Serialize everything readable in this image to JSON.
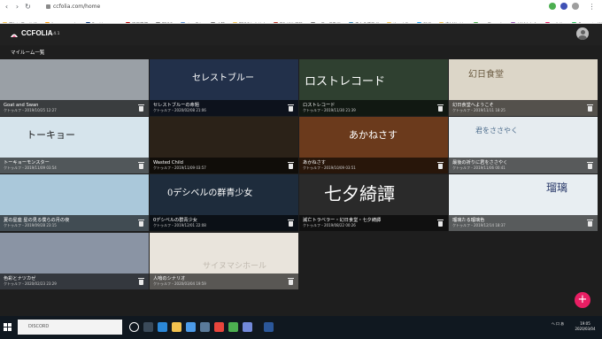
{
  "browser": {
    "url": "ccfolia.com/home",
    "bookmarks": [
      "新しいフォルダ",
      "Amazon.co.jp",
      "Booking.com",
      "楽天市場",
      "TRPG",
      "キャラシ",
      "人狼",
      "TRPGシナリオ",
      "TO-KIX 忍殺",
      "ニコニコ動画",
      "赤小のブログ",
      "ゆっくり",
      "SNS",
      "素材サイト",
      "ユニフォーム",
      "どどんとふ",
      "ccfolia",
      "Evernote Web"
    ],
    "icons": [
      "back-icon",
      "forward-icon",
      "reload-icon",
      "lock-icon",
      "extension-icon",
      "profile-icon",
      "menu-icon"
    ]
  },
  "app": {
    "name": "CCFOLIA",
    "version": "1.4.1",
    "section_label": "マイルーム一覧",
    "fab_label": "+",
    "accent": "#e91e63"
  },
  "rooms": [
    {
      "title": "Goat and Swan",
      "sub": "クトゥルフ・2019/10/25 12:27",
      "art": "",
      "art_color": "#9aa0a6"
    },
    {
      "title": "セレストブルーの命題",
      "sub": "クトゥルフ・2020/02/08 21:06",
      "art": "セレストブルー",
      "art_color": "#22304a"
    },
    {
      "title": "ロストレコード",
      "sub": "クトゥルフ・2019/11/30 21:39",
      "art": "ロストレコード",
      "art_color": "#2f4030"
    },
    {
      "title": "幻日食堂へようこそ",
      "sub": "クトゥルフ・2019/11/11 18:25",
      "art": "幻日食堂",
      "art_color": "#dcd6c8"
    },
    {
      "title": "トーキョーモンスター",
      "sub": "クトゥルフ・2019/11/09 03:54",
      "art": "トーキョー",
      "art_color": "#d6e4ec"
    },
    {
      "title": "Wasted Child",
      "sub": "クトゥルフ・2019/11/09 03:57",
      "art": "",
      "art_color": "#2b2218"
    },
    {
      "title": "あかねさす",
      "sub": "クトゥルフ・2019/10/09 03:51",
      "art": "あかねさす",
      "art_color": "#6b3a1c"
    },
    {
      "title": "最後の祈りに君をささやく",
      "sub": "クトゥルフ・2019/11/06 00:41",
      "art": "君をささやく",
      "art_color": "#e6ecf0"
    },
    {
      "title": "夏の星座 星の見る僕らの月の夜",
      "sub": "クトゥルフ・2019/09/28 23:15",
      "art": "",
      "art_color": "#aac8da"
    },
    {
      "title": "0デシベルの群青少女",
      "sub": "クトゥルフ・2019/12/01 22:08",
      "art": "0デシベルの群青少女",
      "art_color": "#1e2c3c"
    },
    {
      "title": "滅亡トラベラー・幻日食堂・七夕綺譚",
      "sub": "クトゥルフ・2019/08/22 00:26",
      "art": "七夕綺譚",
      "art_color": "#2a2a2a"
    },
    {
      "title": "瑠璃たる瑠璃色",
      "sub": "クトゥルフ・2019/12/14 18:37",
      "art": "瑠璃",
      "art_color": "#e8eef2"
    },
    {
      "title": "色彩とナツカゼ",
      "sub": "クトゥルフ・2020/02/23 23:29",
      "art": "",
      "art_color": "#8a94a4"
    },
    {
      "title": "人喰のシナリオ",
      "sub": "クトゥルフ・2020/03/04 19:59",
      "art": "サイヌマシホール",
      "art_color": "#e9e4dc"
    }
  ],
  "taskbar": {
    "search_placeholder": "DISCORD",
    "tray_text": "へ 口 あ",
    "time": "19:05",
    "date": "2020/03/04"
  }
}
